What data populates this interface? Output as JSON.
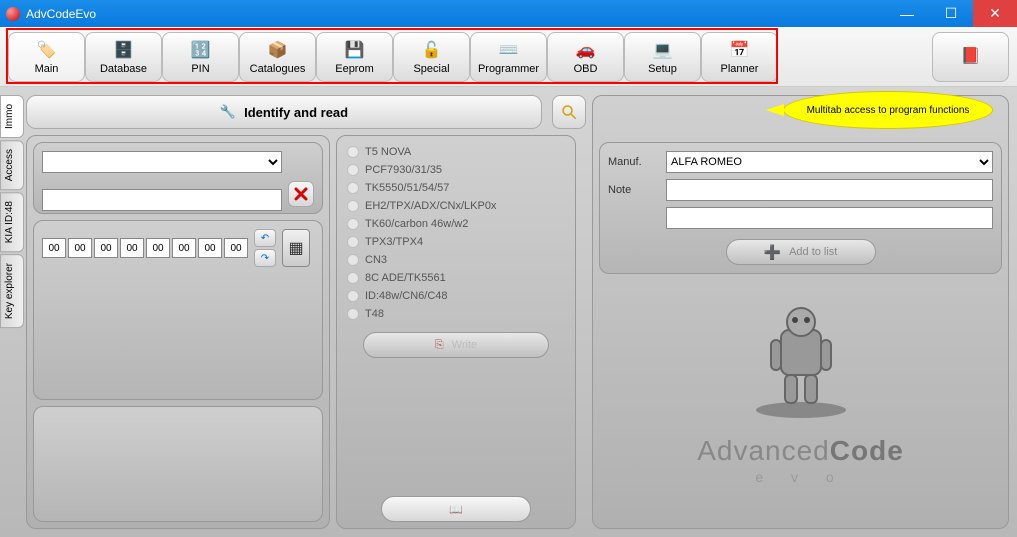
{
  "window": {
    "title": "AdvCodeEvo"
  },
  "toolbar": [
    {
      "id": "main",
      "label": "Main",
      "icon": "🏷️",
      "active": true
    },
    {
      "id": "database",
      "label": "Database",
      "icon": "🗄️"
    },
    {
      "id": "pin",
      "label": "PIN",
      "icon": "🔢"
    },
    {
      "id": "catalogues",
      "label": "Catalogues",
      "icon": "📦"
    },
    {
      "id": "eeprom",
      "label": "Eeprom",
      "icon": "💾"
    },
    {
      "id": "special",
      "label": "Special",
      "icon": "🔓"
    },
    {
      "id": "programmer",
      "label": "Programmer",
      "icon": "⌨️"
    },
    {
      "id": "obd",
      "label": "OBD",
      "icon": "🚗"
    },
    {
      "id": "setup",
      "label": "Setup",
      "icon": "💻"
    },
    {
      "id": "planner",
      "label": "Planner",
      "icon": "📅"
    }
  ],
  "side_tabs": [
    {
      "id": "immo",
      "label": "Immo",
      "active": true
    },
    {
      "id": "access",
      "label": "Access"
    },
    {
      "id": "kia",
      "label": "KIA ID:48"
    },
    {
      "id": "keyexp",
      "label": "Key explorer"
    }
  ],
  "identify": {
    "label": "Identify and read"
  },
  "hex": {
    "values": [
      "00",
      "00",
      "00",
      "00",
      "00",
      "00",
      "00",
      "00"
    ]
  },
  "radios": [
    "T5 NOVA",
    "PCF7930/31/35",
    "TK5550/51/54/57",
    "EH2/TPX/ADX/CNx/LKP0x",
    "TK60/carbon 46w/w2",
    "TPX3/TPX4",
    "CN3",
    "8C ADE/TK5561",
    "ID:48w/CN6/C48",
    "T48"
  ],
  "write_btn": "Write",
  "form": {
    "manuf_label": "Manuf.",
    "manuf_value": "ALFA ROMEO",
    "note_label": "Note",
    "note1": "",
    "note2": "",
    "add_btn": "Add to list"
  },
  "callout": "Multitab access to program functions",
  "brand": {
    "line1a": "Advanced",
    "line1b": "Code",
    "line2": "e v o"
  }
}
